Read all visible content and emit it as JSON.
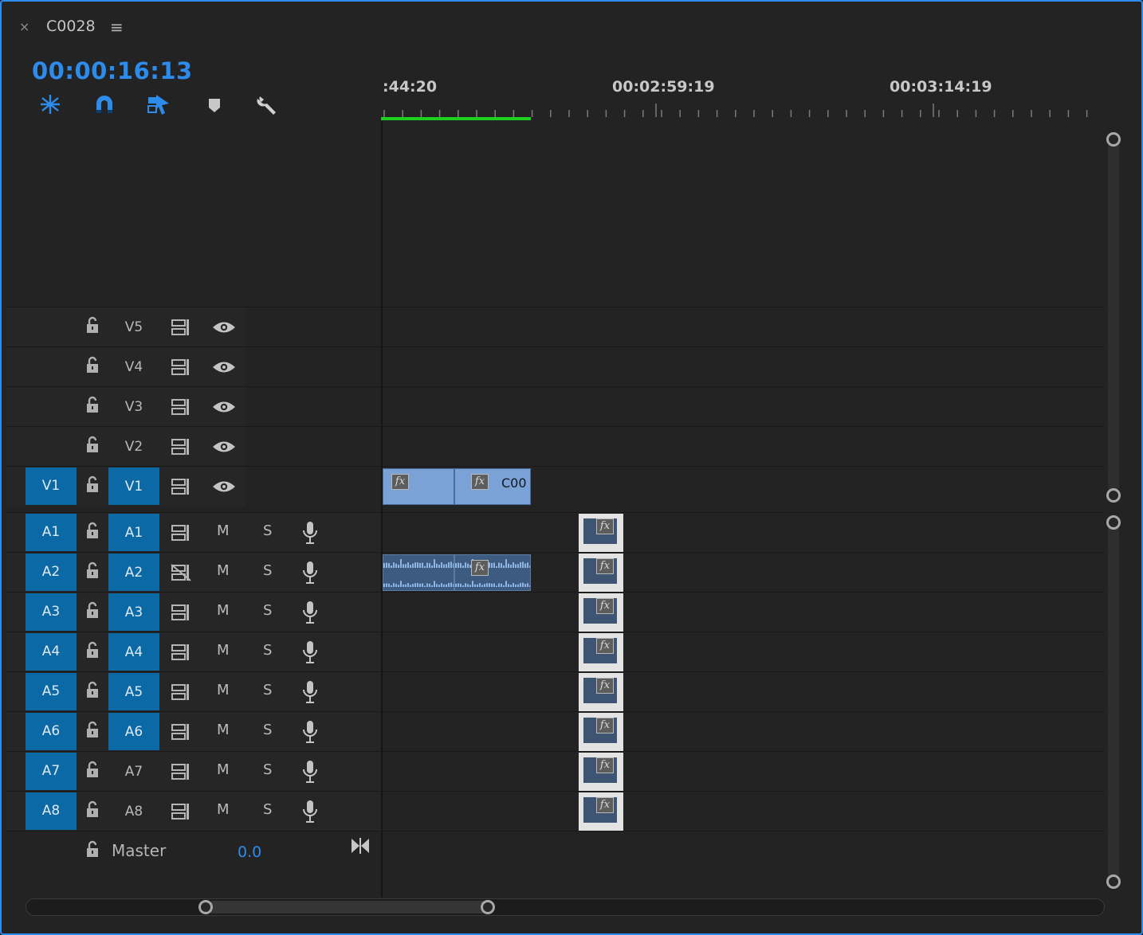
{
  "panel": {
    "close_glyph": "×",
    "title": "C0028",
    "menu_glyph": "≡",
    "timecode": "00:00:16:13"
  },
  "toolbar": {
    "tools": [
      "insert-nest-icon",
      "snap-magnet-icon",
      "linked-selection-icon",
      "add-marker-icon",
      "wrench-settings-icon"
    ],
    "accent": "#2d8ceb"
  },
  "ruler": {
    "labels": [
      ":44:20",
      "00:02:59:19",
      "00:03:14:19"
    ],
    "work_area_color": "#1fd11f"
  },
  "video_tracks": [
    {
      "source": "",
      "target": "V5",
      "target_on": false
    },
    {
      "source": "",
      "target": "V4",
      "target_on": false
    },
    {
      "source": "",
      "target": "V3",
      "target_on": false
    },
    {
      "source": "",
      "target": "V2",
      "target_on": false
    },
    {
      "source": "V1",
      "target": "V1",
      "target_on": true
    }
  ],
  "audio_tracks": [
    {
      "source": "A1",
      "target": "A1",
      "target_on": true
    },
    {
      "source": "A2",
      "target": "A2",
      "target_on": true
    },
    {
      "source": "A3",
      "target": "A3",
      "target_on": true
    },
    {
      "source": "A4",
      "target": "A4",
      "target_on": true
    },
    {
      "source": "A5",
      "target": "A5",
      "target_on": true
    },
    {
      "source": "A6",
      "target": "A6",
      "target_on": true
    },
    {
      "source": "A7",
      "target": "A7",
      "target_on": false
    },
    {
      "source": "A8",
      "target": "A8",
      "target_on": false
    }
  ],
  "audio_buttons": {
    "mute": "M",
    "solo": "S"
  },
  "clips": {
    "fx_label": "fx",
    "v1_clip_name": "C00"
  },
  "master": {
    "label": "Master",
    "value": "0.0"
  },
  "colors": {
    "track_target_blue": "#0b6aa6",
    "video_clip": "#7aa2d6",
    "audio_clip": "#3d5a80"
  }
}
